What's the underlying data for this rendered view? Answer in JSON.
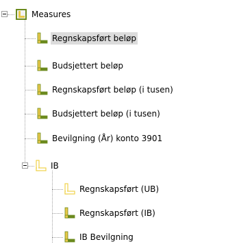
{
  "tree": {
    "root": {
      "label": "Measures",
      "icon": "measure-group-icon",
      "expanded": true
    },
    "measures": [
      {
        "label": "Regnskapsført beløp",
        "icon": "measure-icon",
        "selected": true
      },
      {
        "label": "Budsjettert beløp",
        "icon": "measure-icon"
      },
      {
        "label": "Regnskapsført beløp (i tusen)",
        "icon": "measure-icon"
      },
      {
        "label": "Budsjettert beløp (i tusen)",
        "icon": "measure-icon"
      },
      {
        "label": "Bevilgning (År) konto 3901",
        "icon": "measure-icon"
      }
    ],
    "folder": {
      "label": "IB",
      "icon": "measure-folder-icon",
      "expanded": true,
      "children": [
        {
          "label": "Regnskapsført (UB)",
          "icon": "calculated-measure-icon"
        },
        {
          "label": "Regnskapsført (IB)",
          "icon": "measure-icon"
        },
        {
          "label": "IB Bevilgning",
          "icon": "measure-icon"
        }
      ]
    }
  },
  "colors": {
    "icon_fill": "#e8c84a",
    "icon_stroke": "#6b8a1e",
    "icon_outline_yellow": "#f0d24a",
    "selection_bg": "#dcdcdc"
  }
}
